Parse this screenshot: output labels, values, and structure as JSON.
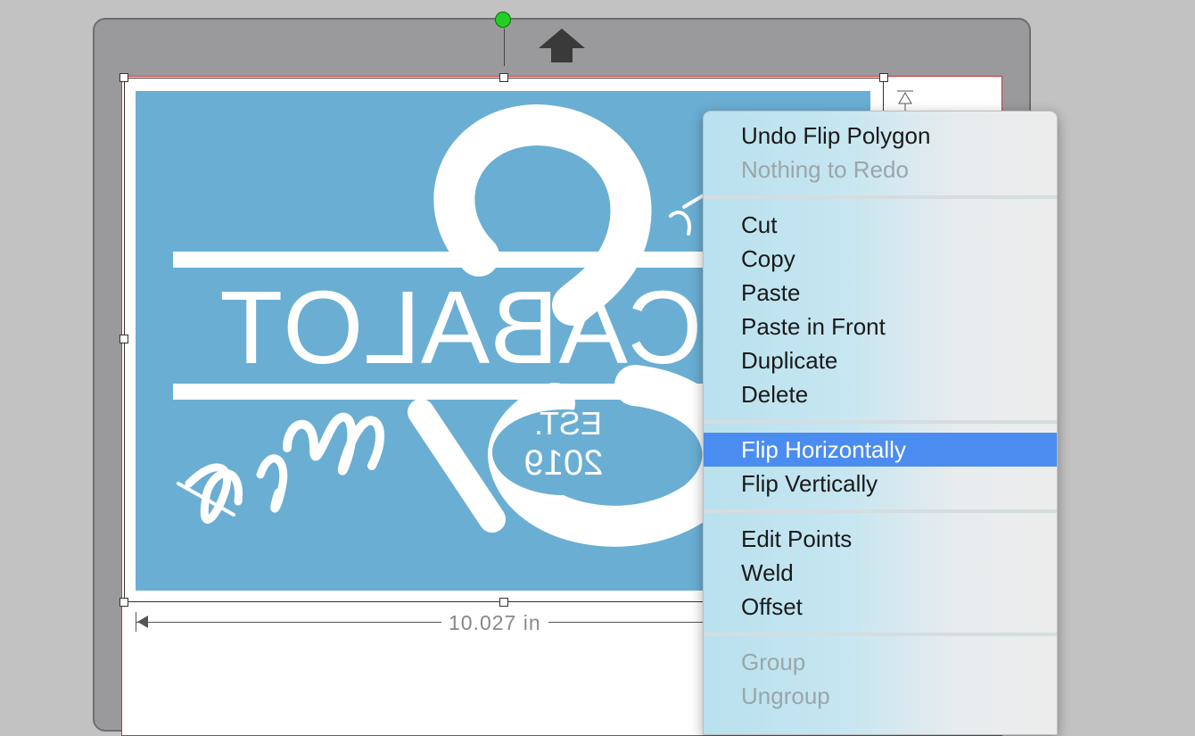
{
  "canvas": {
    "width_dimension_label": "10.027 in"
  },
  "design": {
    "name_mirrored": "CABALOT",
    "est_label_mirrored": "EST.",
    "year_label_mirrored": "2019",
    "script_text": "Mr & Mrs",
    "colors": {
      "background": "#6aaed3",
      "foreground": "#ffffff"
    }
  },
  "context_menu": {
    "undo": "Undo Flip Polygon",
    "redo": "Nothing to Redo",
    "cut": "Cut",
    "copy": "Copy",
    "paste": "Paste",
    "paste_in_front": "Paste in Front",
    "duplicate": "Duplicate",
    "delete": "Delete",
    "flip_horizontally": "Flip Horizontally",
    "flip_vertically": "Flip Vertically",
    "edit_points": "Edit Points",
    "weld": "Weld",
    "offset": "Offset",
    "group": "Group",
    "ungroup": "Ungroup",
    "highlight_color": "#4b8cf0"
  }
}
